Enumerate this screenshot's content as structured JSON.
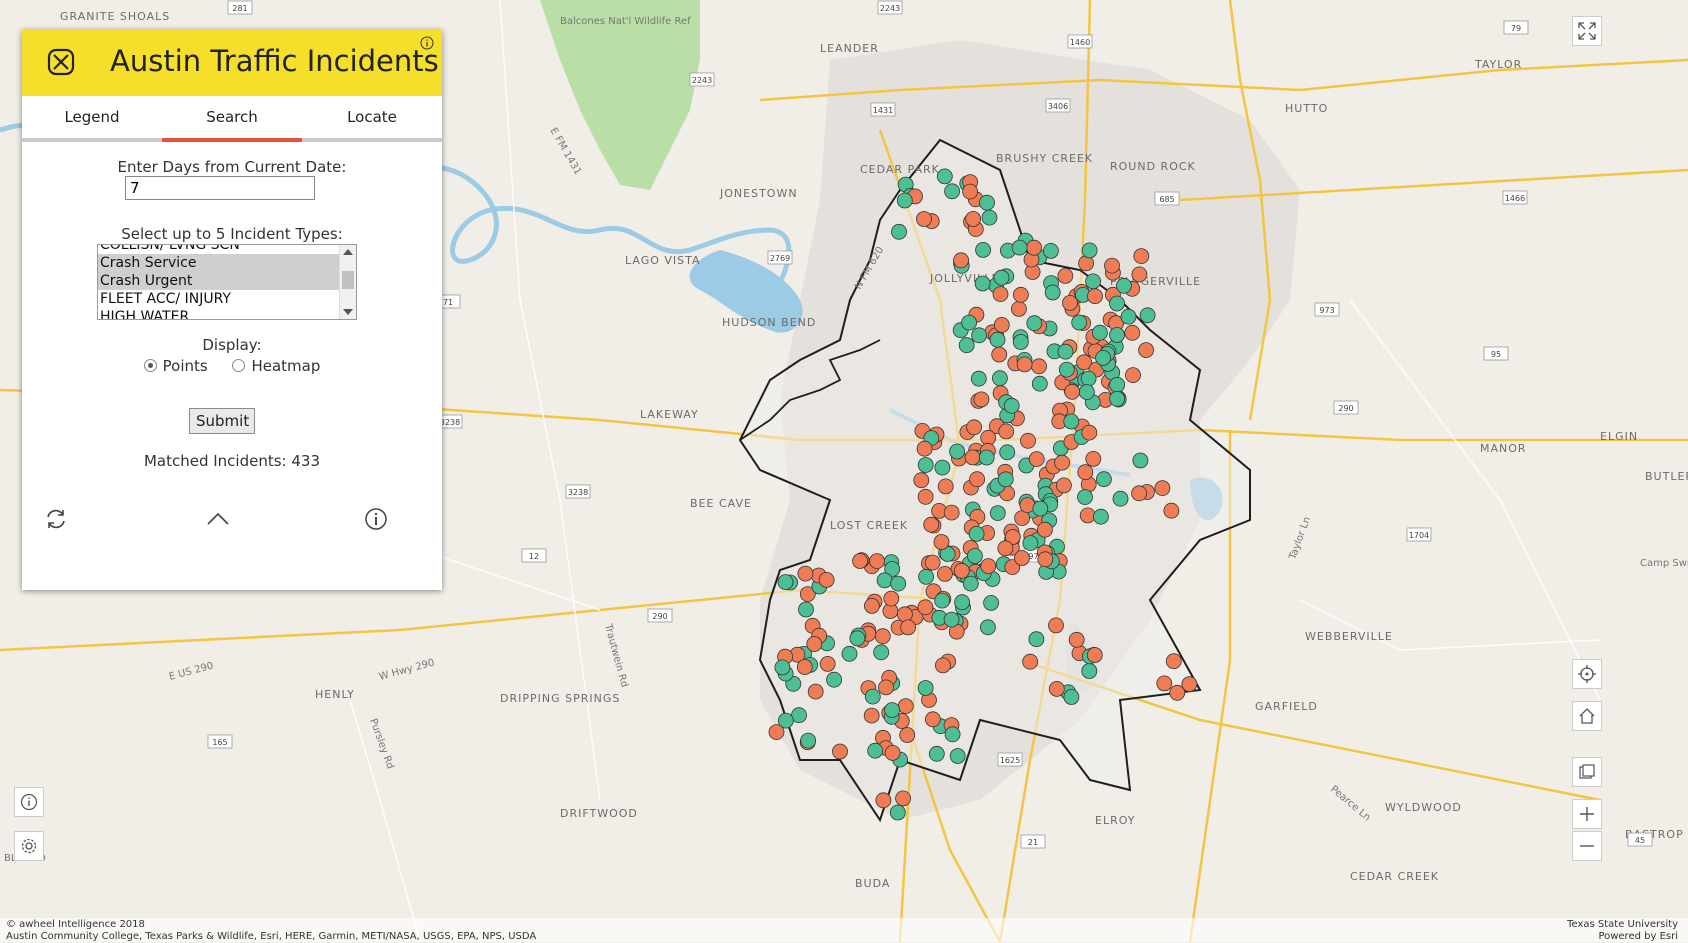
{
  "app": {
    "title": "Austin Traffic Incidents"
  },
  "tabs": [
    {
      "label": "Legend"
    },
    {
      "label": "Search",
      "active": true
    },
    {
      "label": "Locate"
    }
  ],
  "search": {
    "days_label": "Enter Days from Current Date:",
    "days_value": "7",
    "types_label": "Select up to 5 Incident Types:",
    "incident_types": [
      {
        "label": "COLLISN/ LVNG SCN",
        "selected": false
      },
      {
        "label": "Crash Service",
        "selected": true
      },
      {
        "label": "Crash Urgent",
        "selected": true
      },
      {
        "label": "FLEET ACC/ INJURY",
        "selected": false
      },
      {
        "label": "HIGH WATER",
        "selected": false
      }
    ],
    "display_label": "Display:",
    "display_options": [
      {
        "label": "Points",
        "checked": true
      },
      {
        "label": "Heatmap",
        "checked": false
      }
    ],
    "submit_label": "Submit",
    "matched_text": "Matched Incidents: 433"
  },
  "colors": {
    "header": "#f5df2b",
    "active_tab": "#e8523c",
    "crash_service": "#f07c55",
    "crash_urgent": "#4dbf94"
  },
  "map": {
    "places": [
      "GRANITE SHOALS",
      "Balcones Nat'l Wildlife Ref",
      "LEANDER",
      "TAYLOR",
      "HUTTO",
      "CEDAR PARK",
      "BRUSHY CREEK",
      "ROUND ROCK",
      "JONESTOWN",
      "LAGO VISTA",
      "JOLLYVILLE",
      "PFLUGERVILLE",
      "HUDSON BEND",
      "LAKEWAY",
      "MANOR",
      "ELGIN",
      "BEE CAVE",
      "LOST CREEK",
      "WEBBERVILLE",
      "GARFIELD",
      "HENLY",
      "DRIPPING SPRINGS",
      "DRIFTWOOD",
      "BUDA",
      "ELROY",
      "WYLDWOOD",
      "CEDAR CREEK",
      "BLANCO",
      "BASTROP",
      "BUTLER",
      "Camp Swift"
    ],
    "roads": [
      "E US 290",
      "W Hwy 290",
      "Trautwein Rd",
      "Pursley Rd",
      "Taylor Ln",
      "Pearce Ln",
      "E FM 1431",
      "N FM 620"
    ],
    "shields": [
      "281",
      "2243",
      "1460",
      "3406",
      "79",
      "1431",
      "2243",
      "685",
      "1466",
      "2769",
      "71",
      "973",
      "95",
      "290",
      "3238",
      "3238",
      "12",
      "3232",
      "281",
      "290",
      "165",
      "973",
      "1704",
      "1625",
      "21",
      "45"
    ]
  },
  "attribution": {
    "left_line1": "© awheel Intelligence 2018",
    "left_line2": "Austin Community College, Texas Parks & Wildlife, Esri, HERE, Garmin, METI/NASA, USGS, EPA, NPS, USDA",
    "right_line1": "Texas State University",
    "right_line2": "Powered by Esri"
  }
}
